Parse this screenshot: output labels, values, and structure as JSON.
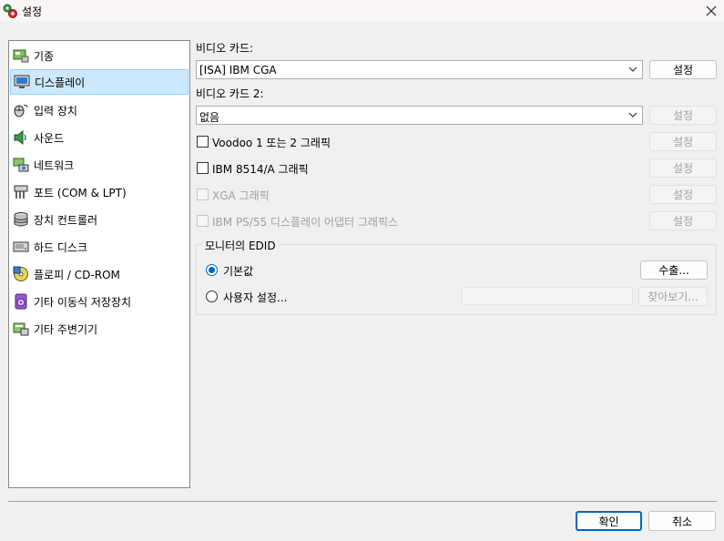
{
  "window": {
    "title": "설정",
    "app_icon": "settings-app-icon",
    "close_icon": "close-icon"
  },
  "sidebar": {
    "items": [
      {
        "label": "기종",
        "icon": "machine-icon"
      },
      {
        "label": "디스플레이",
        "icon": "display-icon",
        "selected": true
      },
      {
        "label": "입력 장치",
        "icon": "input-device-icon"
      },
      {
        "label": "사운드",
        "icon": "sound-icon"
      },
      {
        "label": "네트워크",
        "icon": "network-icon"
      },
      {
        "label": "포트 (COM & LPT)",
        "icon": "ports-icon"
      },
      {
        "label": "장치 컨트롤러",
        "icon": "storage-controller-icon"
      },
      {
        "label": "하드 디스크",
        "icon": "hard-disk-icon"
      },
      {
        "label": "플로피 / CD-ROM",
        "icon": "floppy-cdrom-icon"
      },
      {
        "label": "기타 이동식 저장장치",
        "icon": "removable-storage-icon"
      },
      {
        "label": "기타 주변기기",
        "icon": "peripherals-icon"
      }
    ]
  },
  "display": {
    "video_card_label": "비디오 카드:",
    "video_card_value": "[ISA] IBM CGA",
    "video_card_button": "설정",
    "video_card2_label": "비디오 카드 2:",
    "video_card2_value": "없음",
    "video_card2_button": "설정",
    "options": [
      {
        "label": "Voodoo 1 또는 2 그래픽",
        "checked": false,
        "enabled": true,
        "button": "설정"
      },
      {
        "label": "IBM 8514/A 그래픽",
        "checked": false,
        "enabled": true,
        "button": "설정"
      },
      {
        "label": "XGA 그래픽",
        "checked": false,
        "enabled": false,
        "button": "설정"
      },
      {
        "label": "IBM PS/55 디스플레이 어댑터 그래픽스",
        "checked": false,
        "enabled": false,
        "button": "설정"
      }
    ],
    "edid": {
      "group_label": "모니터의 EDID",
      "default_label": "기본값",
      "default_selected": true,
      "export_button": "수출...",
      "custom_label": "사용자 설정...",
      "custom_path": "",
      "browse_button": "찾아보기..."
    }
  },
  "footer": {
    "ok_button": "확인",
    "cancel_button": "취소"
  },
  "colors": {
    "accent": "#0067c0",
    "selection": "#cce8ff",
    "disabled_text": "#a0a0a0"
  }
}
